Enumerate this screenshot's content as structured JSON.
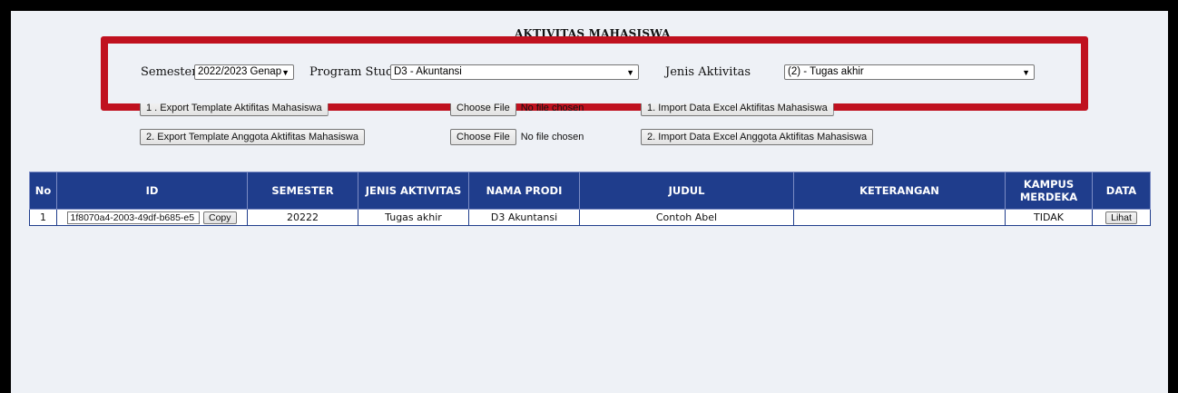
{
  "page": {
    "title": "AKTIVITAS MAHASISWA"
  },
  "filters": {
    "semester_label": "Semester",
    "semester_value": "2022/2023 Genap",
    "prodi_label": "Program Studi",
    "prodi_value": "D3 - Akuntansi",
    "jenis_label": "Jenis Aktivitas",
    "jenis_value": "(2) - Tugas akhir"
  },
  "actions": {
    "export_template": "1 . Export Template Aktifitas Mahasiswa",
    "export_anggota": "2. Export Template Anggota Aktifitas Mahasiswa",
    "choose_file": "Choose File",
    "no_file": "No file chosen",
    "import_data": "1. Import Data Excel Aktifitas Mahasiswa",
    "import_anggota": "2. Import Data Excel Anggota Aktifitas Mahasiswa"
  },
  "table": {
    "headers": {
      "no": "No",
      "id": "ID",
      "semester": "SEMESTER",
      "jenis": "JENIS AKTIVITAS",
      "prodi": "NAMA PRODI",
      "judul": "JUDUL",
      "keterangan": "KETERANGAN",
      "kampus": "KAMPUS MERDEKA",
      "data": "DATA"
    },
    "rows": [
      {
        "no": "1",
        "id": "1f8070a4-2003-49df-b685-e5",
        "copy": "Copy",
        "semester": "20222",
        "jenis": "Tugas akhir",
        "prodi": "D3 Akuntansi",
        "judul": "Contoh Abel",
        "keterangan": "",
        "kampus": "TIDAK",
        "lihat": "Lihat"
      }
    ]
  },
  "colors": {
    "highlight": "#c0111f",
    "header_bg": "#1f3d8c",
    "page_bg": "#eef1f6"
  }
}
